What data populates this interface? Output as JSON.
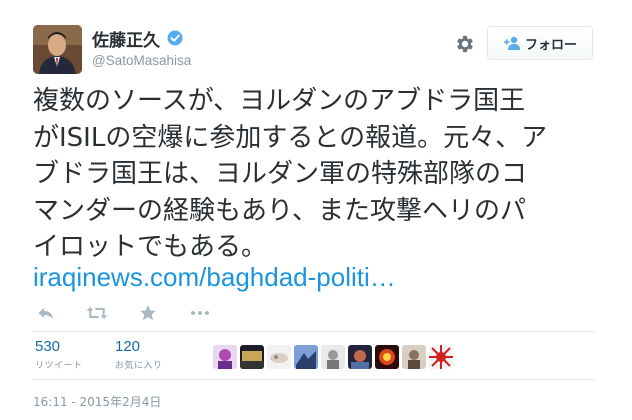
{
  "author": {
    "display_name": "佐藤正久",
    "handle": "@SatoMasahisa",
    "verified": true
  },
  "follow_button": {
    "label": "フォロー",
    "icon": "follow-person-plus-icon"
  },
  "settings_icon": "gear-icon",
  "tweet": {
    "lines": [
      "複数のソースが、ヨルダンのアブドラ国王",
      "がISILの空爆に参加するとの報道。元々、ア",
      "ブドラ国王は、ヨルダン軍の特殊部隊のコ",
      "マンダーの経験もあり、また攻撃ヘリのパ",
      "イロットでもある。"
    ],
    "link": "iraqinews.com/baghdad-politi…"
  },
  "actions": [
    "reply-icon",
    "retweet-icon",
    "favorite-star-icon",
    "more-dots-icon"
  ],
  "stats": {
    "retweets": {
      "count": "530",
      "label": "リツイート"
    },
    "favorites": {
      "count": "120",
      "label": "お気に入り"
    }
  },
  "favorited_by_count_shown": 9,
  "timestamp": "16:11 - 2015年2月4日",
  "colors": {
    "text": "#292f33",
    "muted": "#8899a6",
    "link": "#1b95e0",
    "stat_number": "#1b6aa5",
    "verified_badge": "#55acee",
    "divider": "#e1e8ed"
  }
}
